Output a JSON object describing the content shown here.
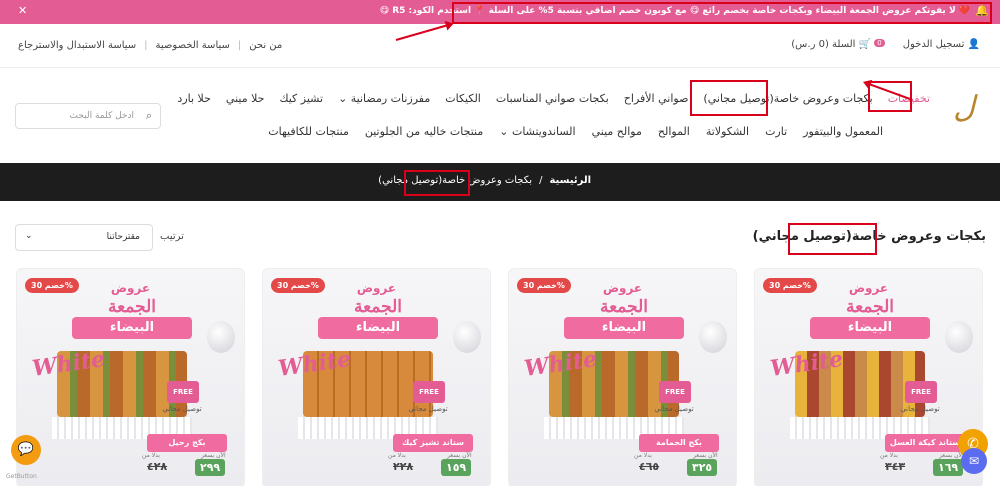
{
  "announcement": {
    "text": "❤️ لا يفوتكم عروض الجمعة البيضاء وبكجات خاصة بخصم رائع 😋 مع كوبون خصم اضافي بنسبة 5% على السلة 📍 استخدم الكود: R5 😋",
    "close": "✕",
    "bell": "🔔"
  },
  "topbar": {
    "login": "تسجيل الدخول",
    "cart_label": "السلة (0 ر.س)",
    "cart_count": "0",
    "links": [
      "من نحن",
      "سياسة الخصوصية",
      "سياسة الاستبدال والاسترجاع"
    ]
  },
  "logo": {
    "text": "ل"
  },
  "nav": {
    "row1": [
      "تخفيضات",
      "بكجات وعروض خاصة(توصيل مجاني)",
      "صواني الأفراح",
      "بكجات صواني المناسبات",
      "الكيكات",
      "مفرزنات رمضانية ⌄",
      "تشيز كيك",
      "حلا ميني",
      "حلا بارد"
    ],
    "row2": [
      "المعمول والبيتفور",
      "تارت",
      "الشكولاتة",
      "الموالح",
      "موالح ميني",
      "الساندويتشات ⌄",
      "منتجات خاليه من الجلوتين",
      "منتجات للكافيهات"
    ]
  },
  "search": {
    "placeholder": "ادخل كلمة البحث",
    "icon": "⌕"
  },
  "breadcrumb": {
    "home": "الرئيسية",
    "sep": "/",
    "current": "بكجات وعروض خاصة(توصيل مجاني)"
  },
  "page": {
    "title": "بكجات وعروض خاصة(توصيل مجاني)",
    "sort_label": "ترتيب",
    "sort_value": "مقترحاتنا",
    "sort_chevron": "⌄"
  },
  "products": [
    {
      "discount": "خصم 30%",
      "brand": "عروض",
      "headline": "الجمعة",
      "ribbon": "البيضاء",
      "white": "White",
      "truck": "FREE",
      "free": "توصيل مجاني",
      "name": "ستاند كيكة العسل",
      "old_label": "بدلا من",
      "new_label": "الآن بسعر",
      "old": "٣٤٣",
      "new": "١٦٩"
    },
    {
      "discount": "خصم 30%",
      "brand": "عروض",
      "headline": "الجمعة",
      "ribbon": "البيضاء",
      "white": "White",
      "truck": "FREE",
      "free": "توصيل مجاني",
      "name": "بكج الحمامة",
      "old_label": "بدلا من",
      "new_label": "الآن بسعر",
      "old": "٤٦٥",
      "new": "٣٢٥"
    },
    {
      "discount": "خصم 30%",
      "brand": "عروض",
      "headline": "الجمعة",
      "ribbon": "البيضاء",
      "white": "White",
      "truck": "FREE",
      "free": "توصيل مجاني",
      "name": "ستاند تشيز كيك",
      "old_label": "بدلا من",
      "new_label": "الآن بسعر",
      "old": "٢٢٨",
      "new": "١٥٩"
    },
    {
      "discount": "خصم 30%",
      "brand": "عروض",
      "headline": "الجمعة",
      "ribbon": "البيضاء",
      "white": "White",
      "truck": "FREE",
      "free": "توصيل مجاني",
      "name": "بكج رحيل",
      "old_label": "بدلا من",
      "new_label": "الآن بسعر",
      "old": "٤٢٨",
      "new": "٢٩٩"
    }
  ],
  "fabs": {
    "whatsapp": "✆",
    "messenger": "✉",
    "chat": "💬"
  },
  "watermark": "GetButton"
}
